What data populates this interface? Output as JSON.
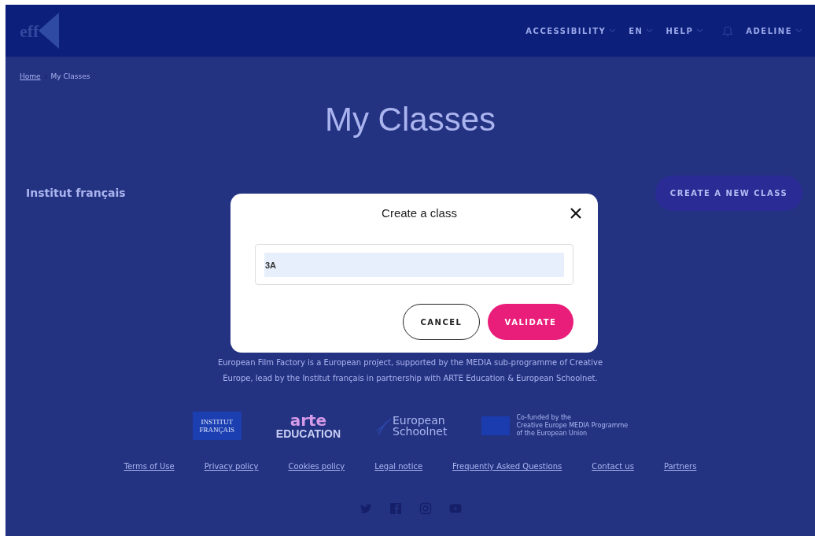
{
  "header": {
    "logo": "eff",
    "nav": [
      {
        "label": "ACCESSIBILITY"
      },
      {
        "label": "EN"
      },
      {
        "label": "HELP"
      }
    ],
    "user": "ADELINE"
  },
  "breadcrumb": [
    {
      "label": "Home",
      "link": true
    },
    {
      "label": "My Classes",
      "link": false
    }
  ],
  "title": "My Classes",
  "organization": "Institut français",
  "create_button": "CREATE A NEW CLASS",
  "footer": {
    "text": "European Film Factory is a European project, supported by the MEDIA sub-programme of Creative Europe, lead by the Institut français in partnership with ARTE Education & European Schoolnet.",
    "logos": [
      {
        "kind": "box",
        "lines": [
          "INSTITUT",
          "FRANÇAIS"
        ]
      },
      {
        "kind": "arte",
        "lines": [
          "arte",
          "EDUCATION"
        ]
      },
      {
        "kind": "schoolnet",
        "lines": [
          "European",
          "Schoolnet"
        ]
      },
      {
        "kind": "eu",
        "lines": [
          "Co-funded by the",
          "Creative Europe MEDIA Programme",
          "of the European Union"
        ]
      }
    ],
    "links": [
      "Terms of Use",
      "Privacy policy",
      "Cookies policy",
      "Legal notice",
      "Frequently Asked Questions",
      "Contact us",
      "Partners"
    ]
  },
  "modal": {
    "title": "Create a class",
    "value": "3A",
    "buttons": [
      {
        "label": "CANCEL",
        "kind": "secondary"
      },
      {
        "label": "VALIDATE",
        "kind": "primary"
      }
    ]
  }
}
